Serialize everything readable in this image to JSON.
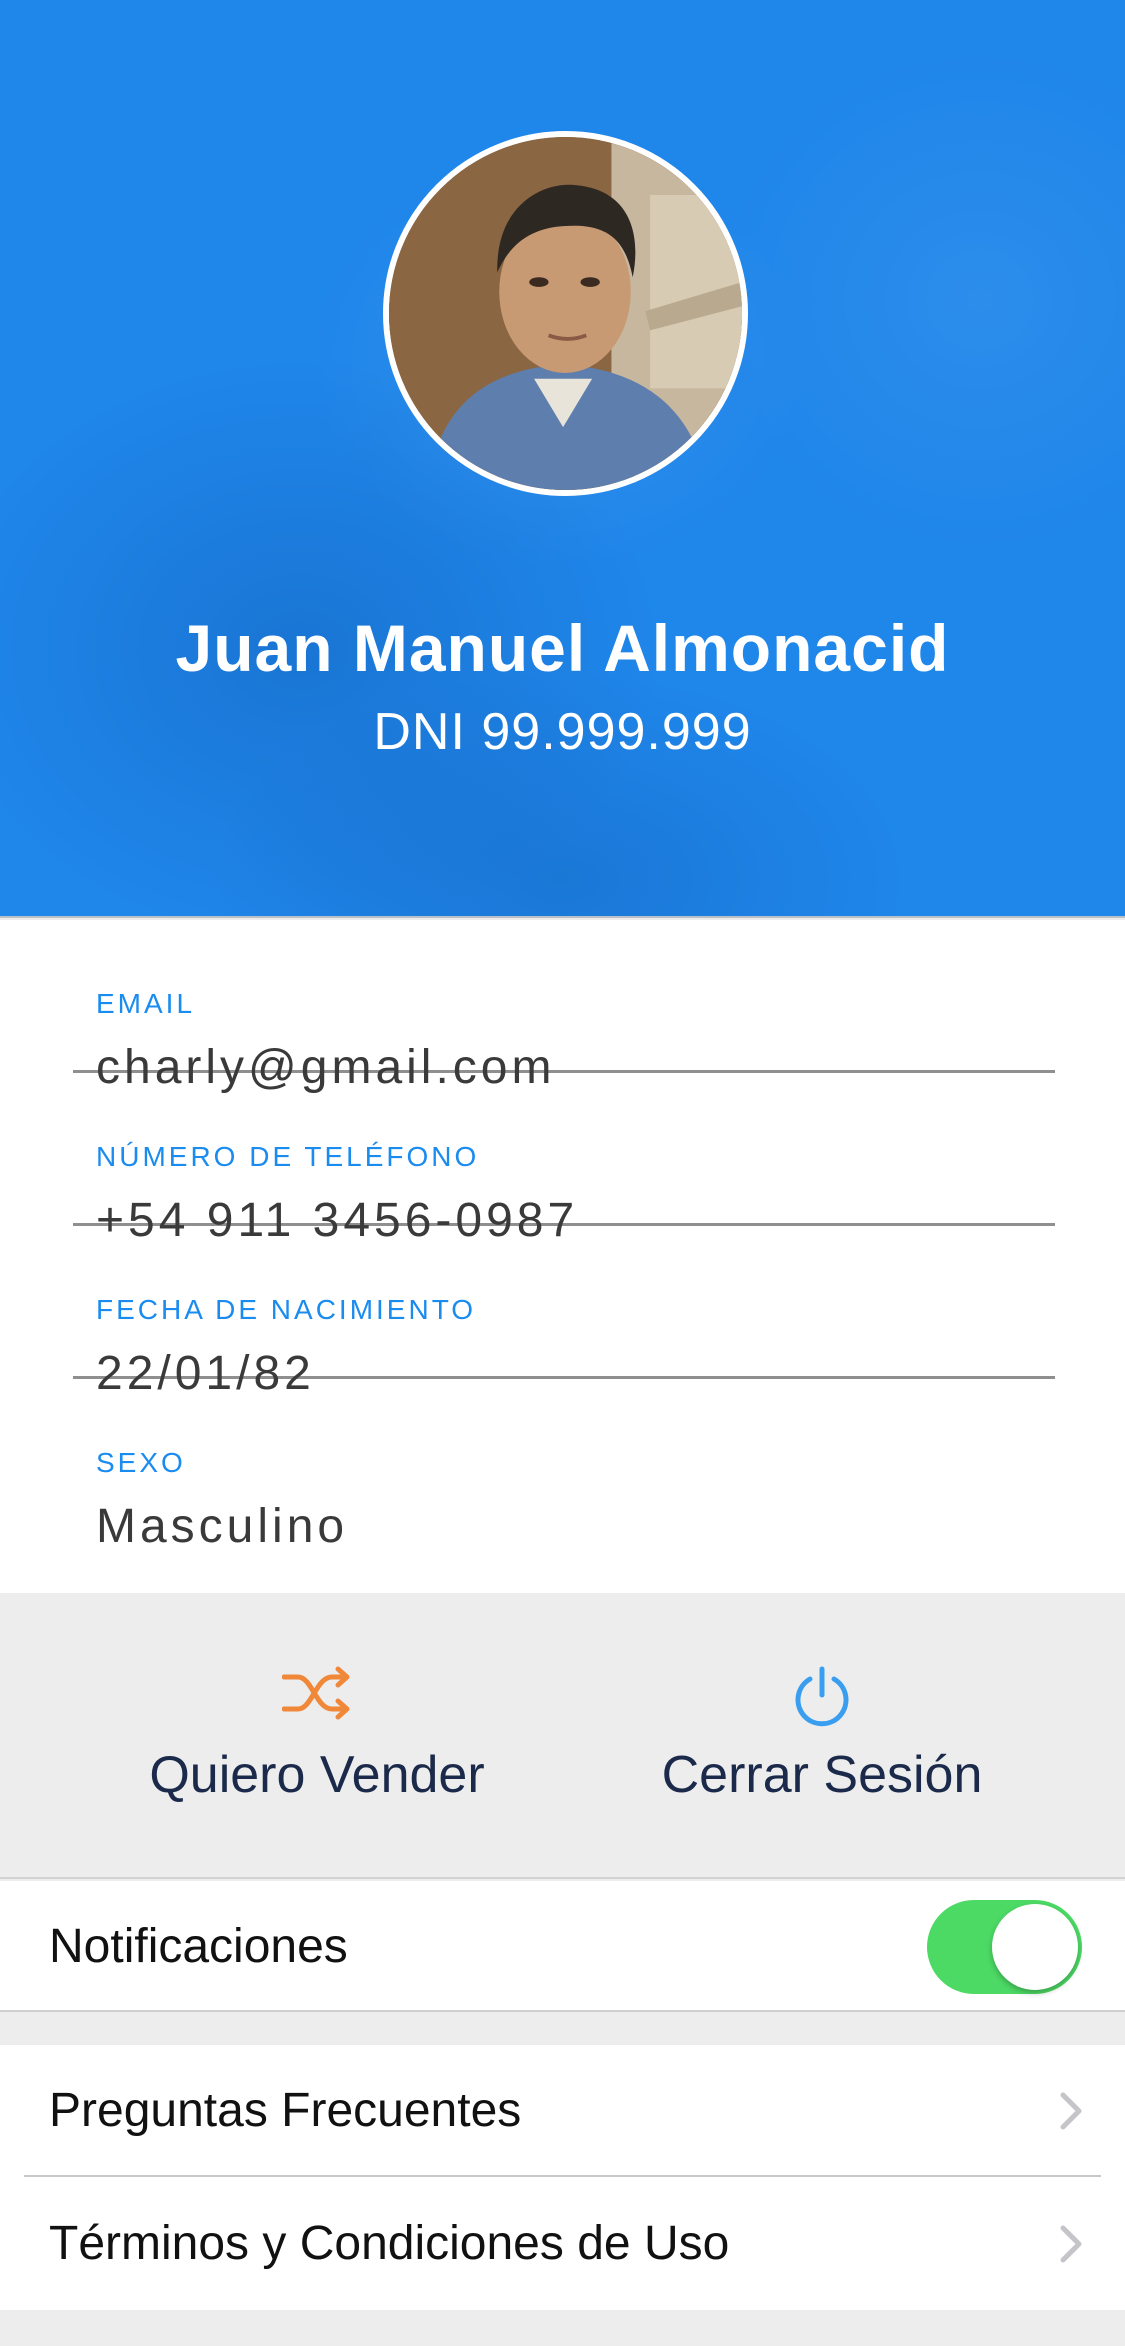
{
  "profile": {
    "name": "Juan Manuel Almonacid",
    "dni": "DNI 99.999.999"
  },
  "fields": [
    {
      "label": "EMAIL",
      "value": "charly@gmail.com"
    },
    {
      "label": "NÚMERO DE TELÉFONO",
      "value": "+54 911 3456-0987"
    },
    {
      "label": "FECHA DE NACIMIENTO",
      "value": "22/01/82"
    },
    {
      "label": "SEXO",
      "value": "Masculino"
    }
  ],
  "actions": {
    "sell": {
      "label": "Quiero Vender",
      "icon": "shuffle-icon",
      "color": "#f0883a"
    },
    "logout": {
      "label": "Cerrar Sesión",
      "icon": "power-icon",
      "color": "#3a9ef0"
    }
  },
  "notifications": {
    "label": "Notificaciones",
    "enabled": true,
    "color": "#4cd964"
  },
  "menu": [
    {
      "label": "Preguntas Frecuentes",
      "icon": "chevron-right-icon"
    },
    {
      "label": "Términos y Condiciones de Uso",
      "icon": "chevron-right-icon"
    }
  ],
  "colors": {
    "header": "#1f86ea",
    "accent": "#1a8cf0",
    "background": "#ededed"
  }
}
